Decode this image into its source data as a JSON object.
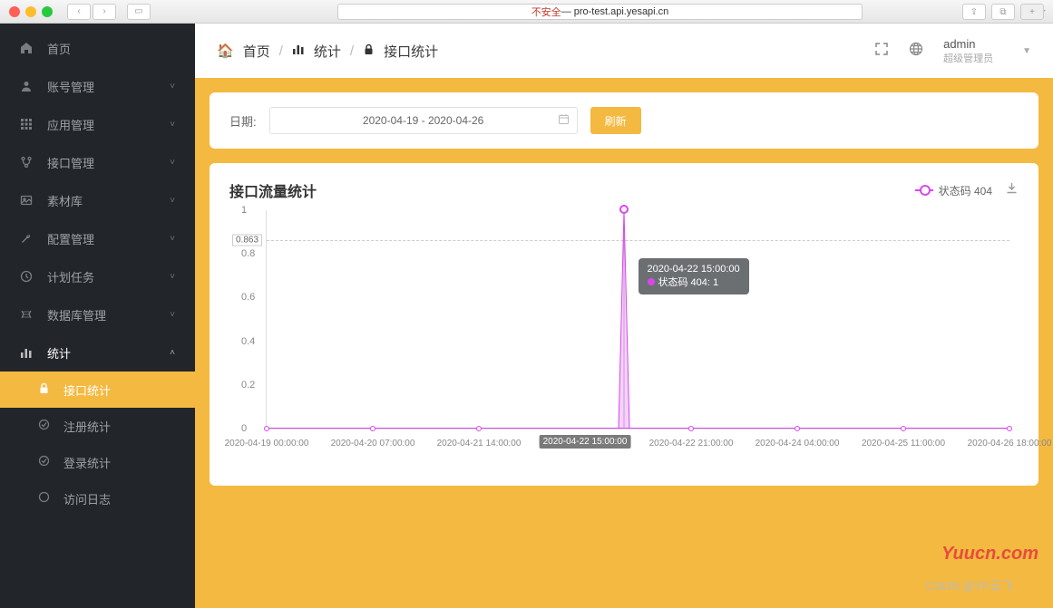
{
  "browser": {
    "insecure_label": "不安全",
    "url": " — pro-test.api.yesapi.cn"
  },
  "sidebar": {
    "items": [
      {
        "icon": "home",
        "label": "首页",
        "expandable": false
      },
      {
        "icon": "person",
        "label": "账号管理",
        "expandable": true
      },
      {
        "icon": "apps",
        "label": "应用管理",
        "expandable": true
      },
      {
        "icon": "fork",
        "label": "接口管理",
        "expandable": true
      },
      {
        "icon": "photo",
        "label": "素材库",
        "expandable": true
      },
      {
        "icon": "wrench",
        "label": "配置管理",
        "expandable": true
      },
      {
        "icon": "clock",
        "label": "计划任务",
        "expandable": true
      },
      {
        "icon": "db",
        "label": "数据库管理",
        "expandable": true
      },
      {
        "icon": "stats",
        "label": "统计",
        "expandable": true,
        "expanded": true
      }
    ],
    "sub_items": [
      {
        "icon": "lock",
        "label": "接口统计",
        "active": true
      },
      {
        "icon": "circle-check",
        "label": "注册统计",
        "active": false
      },
      {
        "icon": "circle-check",
        "label": "登录统计",
        "active": false
      },
      {
        "icon": "circle",
        "label": "访问日志",
        "active": false
      }
    ]
  },
  "breadcrumb": [
    {
      "icon": "home",
      "label": "首页"
    },
    {
      "icon": "stats",
      "label": "统计"
    },
    {
      "icon": "lock",
      "label": "接口统计"
    }
  ],
  "header": {
    "user_name": "admin",
    "user_role": "超级管理员"
  },
  "filter": {
    "date_label": "日期:",
    "date_value": "2020-04-19 - 2020-04-26",
    "refresh_label": "刷新"
  },
  "chart": {
    "title": "接口流量统计",
    "legend_label": "状态码 404",
    "marker_value": "0.863",
    "tooltip_time": "2020-04-22 15:00:00",
    "tooltip_series": "状态码 404: 1"
  },
  "chart_data": {
    "type": "line",
    "title": "接口流量统计",
    "xlabel": "",
    "ylabel": "",
    "ylim": [
      0,
      1
    ],
    "y_ticks": [
      0,
      0.2,
      0.4,
      0.6,
      0.8,
      1
    ],
    "marker_line": 0.863,
    "series": [
      {
        "name": "状态码 404",
        "color": "#d946ef"
      }
    ],
    "x": [
      "2020-04-19 00:00:00",
      "2020-04-20 07:00:00",
      "2020-04-21 14:00:00",
      "2020-04-22 15:00:00",
      "2020-04-22 21:00:00",
      "2020-04-24 04:00:00",
      "2020-04-25 11:00:00",
      "2020-04-26 18:00:00"
    ],
    "values": [
      0,
      0,
      0,
      1,
      0,
      0,
      0,
      0
    ],
    "active_x_index": 3,
    "tooltip": {
      "time": "2020-04-22 15:00:00",
      "text": "状态码 404: 1"
    }
  },
  "watermarks": {
    "csdn": "CSDN @YF云飞",
    "yuucn": "Yuucn.com"
  }
}
